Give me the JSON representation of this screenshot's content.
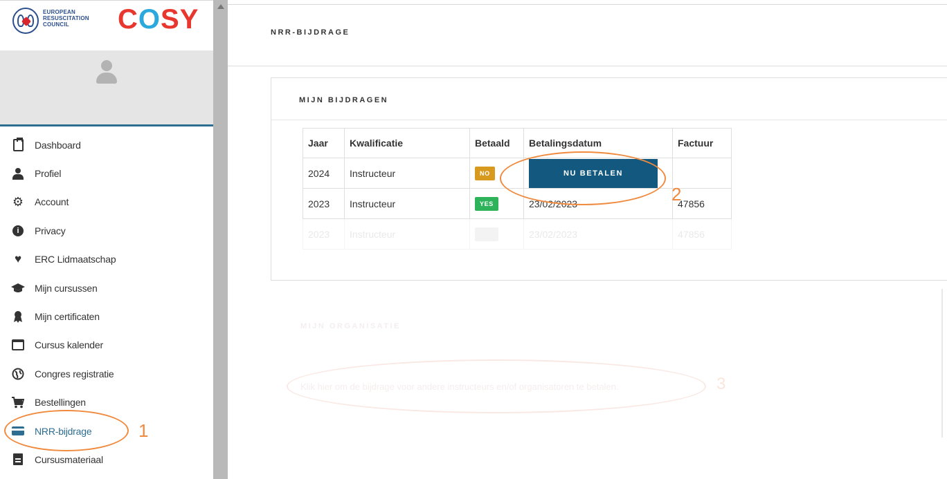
{
  "logo": {
    "org_line1": "EUROPEAN",
    "org_line2": "RESUSCITATION",
    "org_line3": "COUNCIL",
    "app_c": "C",
    "app_o": "O",
    "app_s": "S",
    "app_y": "Y"
  },
  "user": {
    "name": "",
    "role": ""
  },
  "menu": {
    "items": [
      {
        "label": "Dashboard",
        "icon": "clipboard-icon"
      },
      {
        "label": "Profiel",
        "icon": "user-icon"
      },
      {
        "label": "Account",
        "icon": "gear-icon"
      },
      {
        "label": "Privacy",
        "icon": "info-icon"
      },
      {
        "label": "ERC Lidmaatschap",
        "icon": "heart-icon"
      },
      {
        "label": "Mijn cursussen",
        "icon": "graduation-cap-icon"
      },
      {
        "label": "Mijn certificaten",
        "icon": "certificate-icon"
      },
      {
        "label": "Cursus kalender",
        "icon": "calendar-icon"
      },
      {
        "label": "Congres registratie",
        "icon": "globe-icon"
      },
      {
        "label": "Bestellingen",
        "icon": "cart-icon"
      },
      {
        "label": "NRR-bijdrage",
        "icon": "credit-card-icon",
        "active": true
      },
      {
        "label": "Cursusmateriaal",
        "icon": "document-icon"
      }
    ]
  },
  "page": {
    "title": "NRR-BIJDRAGE"
  },
  "contributions": {
    "title": "MIJN BIJDRAGEN",
    "columns": [
      "Jaar",
      "Kwalificatie",
      "Betaald",
      "Betalingsdatum",
      "Factuur"
    ],
    "rows": [
      {
        "year": "2024",
        "qualification": "Instructeur",
        "paid": "NO",
        "action": "NU BETALEN",
        "invoice": ""
      },
      {
        "year": "2023",
        "qualification": "Instructeur",
        "paid": "YES",
        "date": "23/02/2023",
        "invoice": "47856"
      },
      {
        "year": "2023",
        "qualification": "Instructeur",
        "paid": "",
        "date": "23/02/2023",
        "invoice": "47856"
      }
    ]
  },
  "organisation": {
    "title": "MIJN ORGANISATIE",
    "link": "Klik hier om de bijdrage voor andere instructeurs en/of organisatoren te betalen."
  },
  "annotations": [
    "1",
    "2",
    "3"
  ],
  "colors": {
    "accent": "#2d6d91",
    "button": "#13597f",
    "badge_no": "#d89a1e",
    "badge_yes": "#2fb35a",
    "annotation": "#f08a3e"
  }
}
